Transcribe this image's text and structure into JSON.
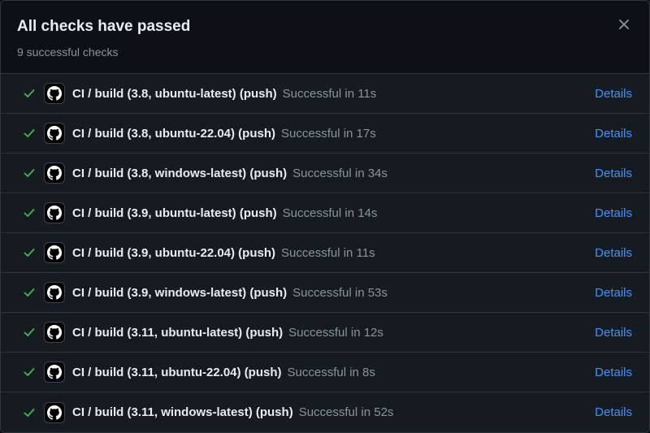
{
  "header": {
    "title": "All checks have passed",
    "subtitle": "9 successful checks",
    "close_icon": "close-icon"
  },
  "colors": {
    "success": "#3fb950",
    "link": "#4493f8",
    "muted": "#8b949e",
    "border": "#30363d",
    "row_background": "#161b22",
    "header_background": "#0d1117"
  },
  "checks": [
    {
      "name": "CI / build (3.8, ubuntu-latest) (push)",
      "status": "Successful in 11s",
      "details": "Details",
      "icon": "github-icon",
      "state_icon": "check-icon"
    },
    {
      "name": "CI / build (3.8, ubuntu-22.04) (push)",
      "status": "Successful in 17s",
      "details": "Details",
      "icon": "github-icon",
      "state_icon": "check-icon"
    },
    {
      "name": "CI / build (3.8, windows-latest) (push)",
      "status": "Successful in 34s",
      "details": "Details",
      "icon": "github-icon",
      "state_icon": "check-icon"
    },
    {
      "name": "CI / build (3.9, ubuntu-latest) (push)",
      "status": "Successful in 14s",
      "details": "Details",
      "icon": "github-icon",
      "state_icon": "check-icon"
    },
    {
      "name": "CI / build (3.9, ubuntu-22.04) (push)",
      "status": "Successful in 11s",
      "details": "Details",
      "icon": "github-icon",
      "state_icon": "check-icon"
    },
    {
      "name": "CI / build (3.9, windows-latest) (push)",
      "status": "Successful in 53s",
      "details": "Details",
      "icon": "github-icon",
      "state_icon": "check-icon"
    },
    {
      "name": "CI / build (3.11, ubuntu-latest) (push)",
      "status": "Successful in 12s",
      "details": "Details",
      "icon": "github-icon",
      "state_icon": "check-icon"
    },
    {
      "name": "CI / build (3.11, ubuntu-22.04) (push)",
      "status": "Successful in 8s",
      "details": "Details",
      "icon": "github-icon",
      "state_icon": "check-icon"
    },
    {
      "name": "CI / build (3.11, windows-latest) (push)",
      "status": "Successful in 52s",
      "details": "Details",
      "icon": "github-icon",
      "state_icon": "check-icon"
    }
  ]
}
